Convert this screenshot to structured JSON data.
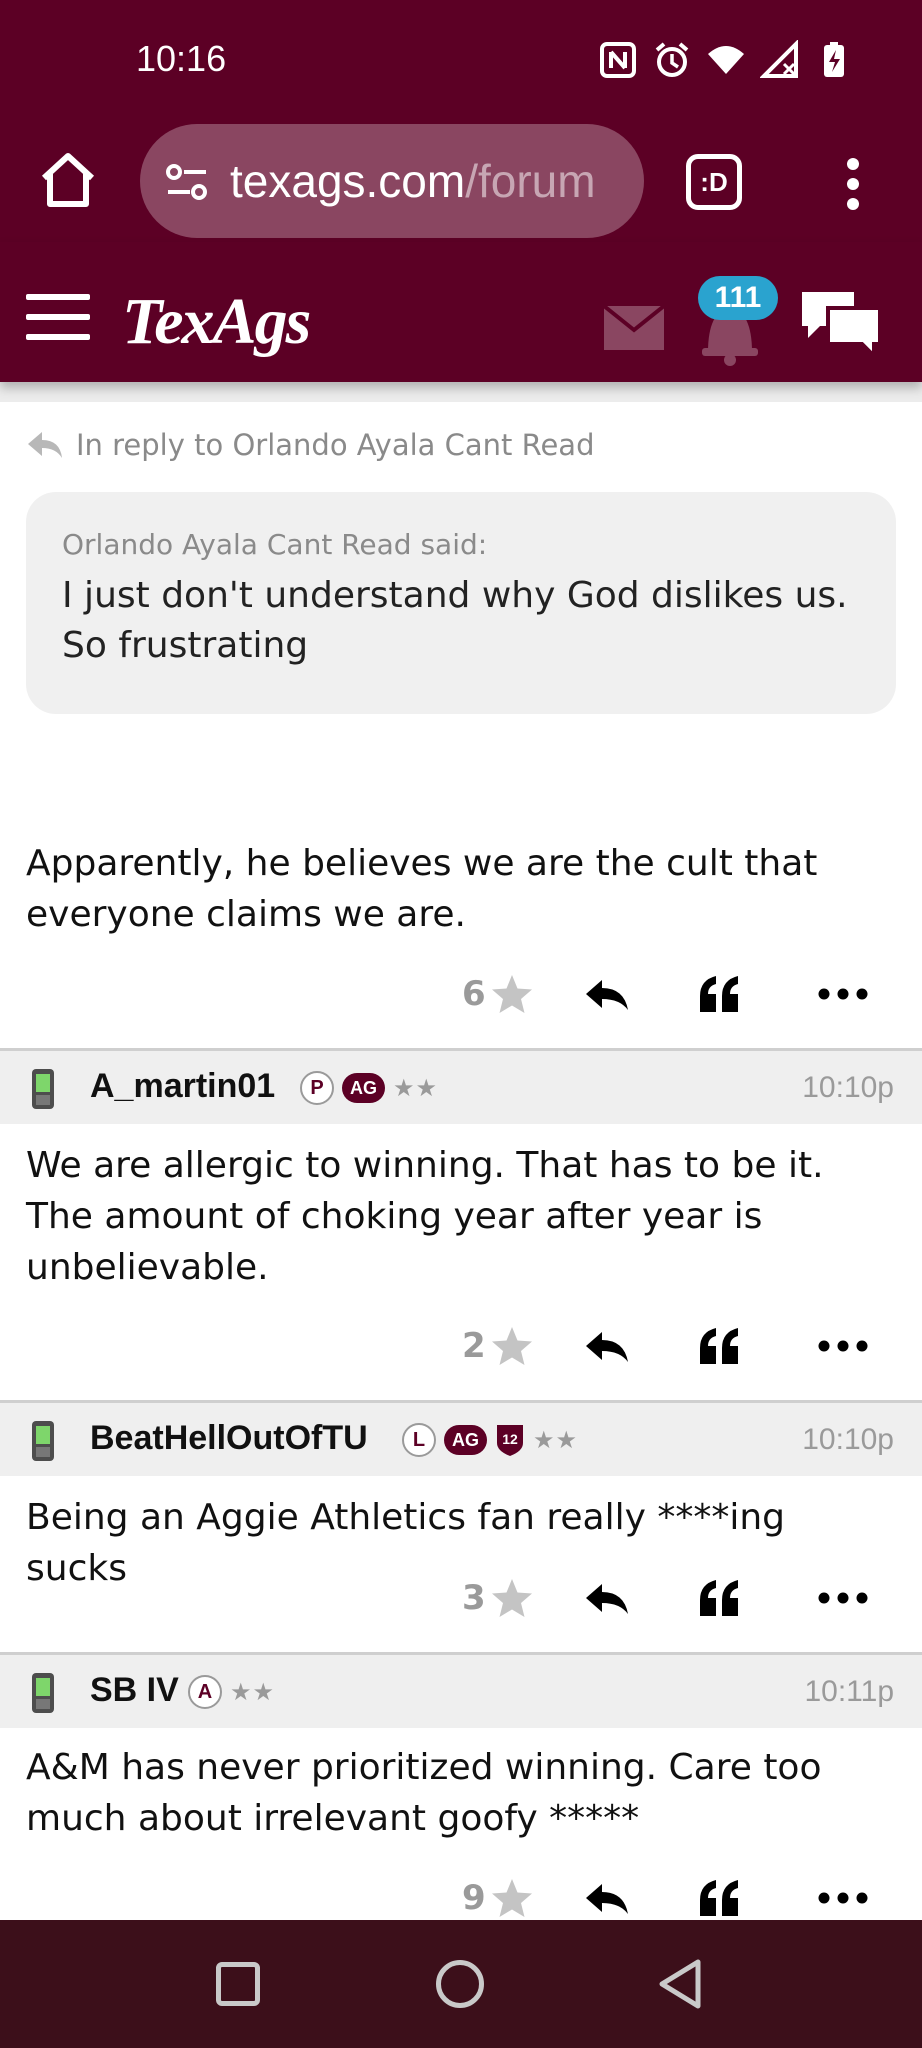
{
  "status_bar": {
    "time": "10:16",
    "icons": [
      "nfc-icon",
      "alarm-icon",
      "wifi-icon",
      "signal-icon",
      "battery-charging-icon"
    ]
  },
  "browser": {
    "url_domain": "texags.com",
    "url_path": "/forum",
    "tab_count_label": ":D"
  },
  "header": {
    "logo": "TexAgs",
    "notification_count": "111"
  },
  "thread": {
    "reply_to": "In reply to Orlando Ayala Cant Read",
    "quote": {
      "author": "Orlando Ayala Cant Read said:",
      "text": "I just don't understand why God dislikes us. So frustrating"
    },
    "first_post": {
      "body": "Apparently, he believes we are the cult that everyone claims we are.",
      "stars": "6"
    },
    "posts": [
      {
        "username": "A_martin01",
        "badges": [
          "P",
          "AG"
        ],
        "rank": "★★",
        "time": "10:10p",
        "body": "We are allergic to winning. That has to be it. The amount of choking year after year is unbelievable.",
        "stars": "2"
      },
      {
        "username": "BeatHellOutOfTU",
        "badges": [
          "L",
          "AG",
          "12"
        ],
        "rank": "★★",
        "time": "10:10p",
        "body": "Being an Aggie Athletics fan really ****ing sucks",
        "stars": "3"
      },
      {
        "username": "SB IV",
        "badges": [
          "A"
        ],
        "rank": "★★",
        "time": "10:11p",
        "body": "A&M has never prioritized winning. Care too much about irrelevant goofy *****",
        "stars": "9"
      }
    ]
  },
  "colors": {
    "maroon": "#5c0025",
    "nav_bar": "#3c0f1a",
    "badge_blue": "#2aa3cf"
  }
}
